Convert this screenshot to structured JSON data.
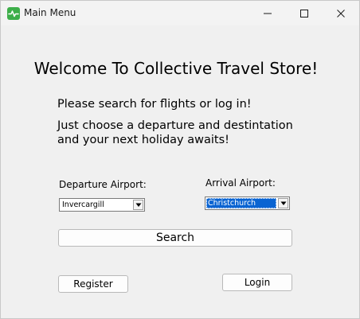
{
  "window": {
    "title": "Main Menu",
    "accent": "#3dae49"
  },
  "main": {
    "heading": "Welcome To Collective Travel Store!",
    "intro_line1": "Please search for flights or log in!",
    "intro_line2": "Just choose a departure and destintation",
    "intro_line3": "and your next holiday awaits!"
  },
  "departure": {
    "label": "Departure Airport:",
    "selected": "Invercargill"
  },
  "arrival": {
    "label": "Arrival Airport:",
    "selected": "Christchurch",
    "highlight": "#0a64d2"
  },
  "buttons": {
    "search": "Search",
    "register": "Register",
    "login": "Login"
  },
  "icons": {
    "app": "app-pulse-icon",
    "minimize": "minimize-icon",
    "maximize": "maximize-icon",
    "close": "close-icon",
    "dropdown": "chevron-down-icon"
  }
}
